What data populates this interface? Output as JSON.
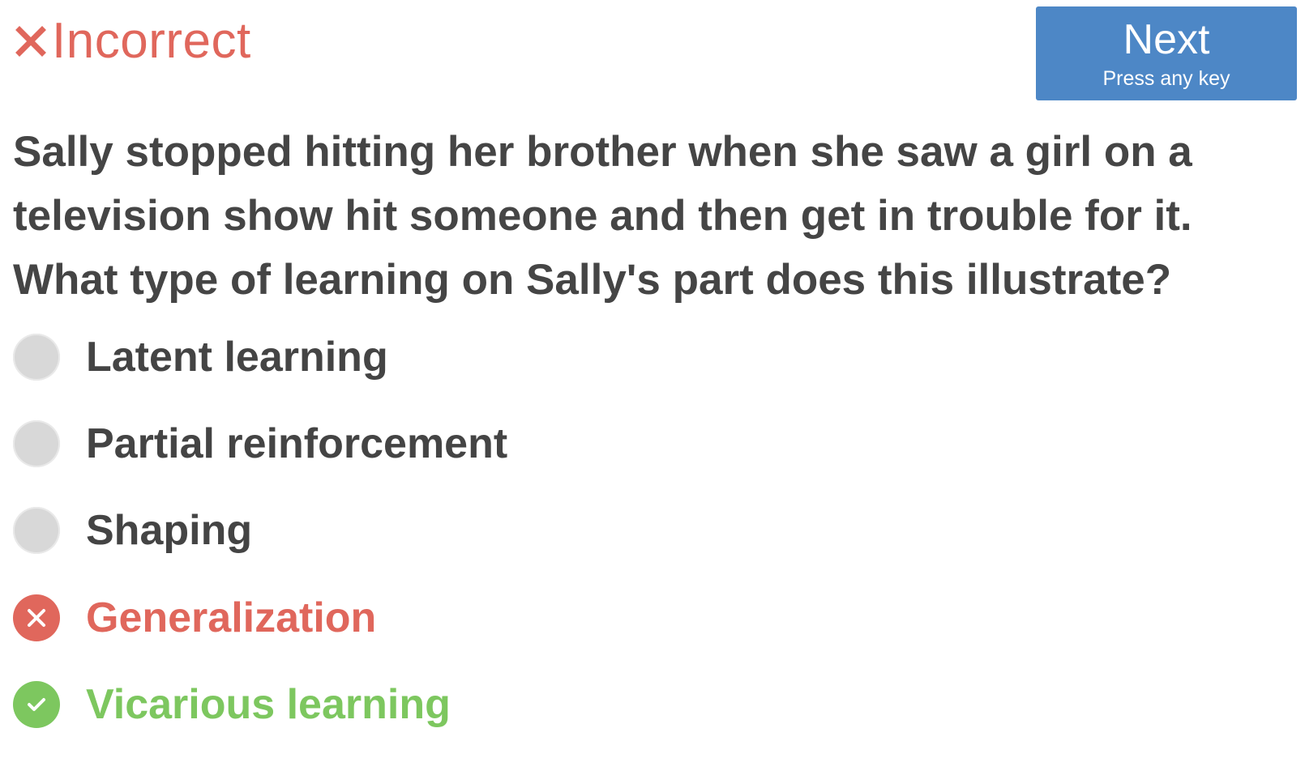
{
  "result": {
    "status": "Incorrect",
    "icon": "x-mark-icon",
    "color": "#e0675c"
  },
  "next_button": {
    "label": "Next",
    "hint": "Press any key",
    "color": "#4d87c6"
  },
  "question": {
    "text": "Sally stopped hitting her brother when she saw a girl on a television show hit someone and then get in trouble for it. What type of learning on Sally's part does this illustrate?"
  },
  "options": [
    {
      "label": "Latent learning",
      "state": "unselected",
      "icon": "radio-empty-icon"
    },
    {
      "label": "Partial reinforcement",
      "state": "unselected",
      "icon": "radio-empty-icon"
    },
    {
      "label": "Shaping",
      "state": "unselected",
      "icon": "radio-empty-icon"
    },
    {
      "label": "Generalization",
      "state": "selected-wrong",
      "icon": "x-circle-icon",
      "color": "#e0675c"
    },
    {
      "label": "Vicarious learning",
      "state": "correct",
      "icon": "check-circle-icon",
      "color": "#7dc75f"
    }
  ]
}
